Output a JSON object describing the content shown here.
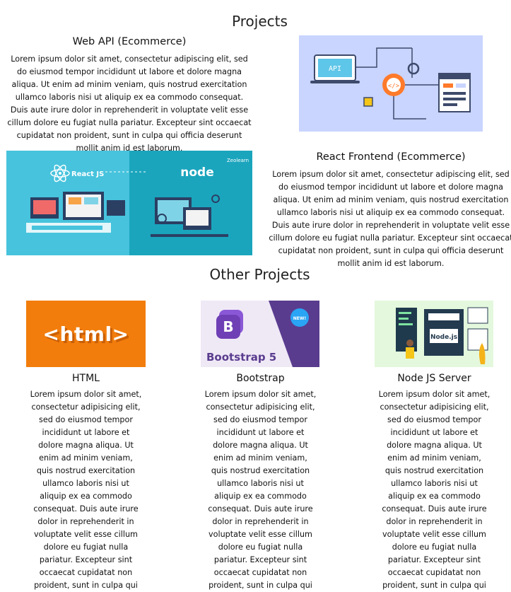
{
  "projects": {
    "heading": "Projects",
    "items": [
      {
        "title": "Web API (Ecommerce)",
        "description": "Lorem ipsum dolor sit amet, consectetur adipiscing elit, sed do eiusmod tempor incididunt ut labore et dolore magna aliqua. Ut enim ad minim veniam, quis nostrud exercitation ullamco laboris nisi ut aliquip ex ea commodo consequat. Duis aute irure dolor in reprehenderit in voluptate velit esse cillum dolore eu fugiat nulla pariatur. Excepteur sint occaecat cupidatat non proident, sunt in culpa qui officia deserunt mollit anim id est laborum.",
        "image_label": "API"
      },
      {
        "title": "React Frontend (Ecommerce)",
        "description": "Lorem ipsum dolor sit amet, consectetur adipiscing elit, sed do eiusmod tempor incididunt ut labore et dolore magna aliqua. Ut enim ad minim veniam, quis nostrud exercitation ullamco laboris nisi ut aliquip ex ea commodo consequat. Duis aute irure dolor in reprehenderit in voluptate velit esse cillum dolore eu fugiat nulla pariatur. Excepteur sint occaecat cupidatat non proident, sunt in culpa qui officia deserunt mollit anim id est laborum.",
        "image_label_left": "React JS",
        "image_label_right": "node",
        "image_brand": "Zeolearn"
      }
    ]
  },
  "other_projects": {
    "heading": "Other Projects",
    "items": [
      {
        "title": "HTML",
        "image_label": "<html>",
        "description": "Lorem ipsum dolor sit amet, consectetur adipisicing elit, sed do eiusmod tempor incididunt ut labore et dolore magna aliqua. Ut enim ad minim veniam, quis nostrud exercitation ullamco laboris nisi ut aliquip ex ea commodo consequat. Duis aute irure dolor in reprehenderit in voluptate velit esse cillum dolore eu fugiat nulla pariatur. Excepteur sint occaecat cupidatat non proident, sunt in culpa qui"
      },
      {
        "title": "Bootstrap",
        "image_label": "Bootstrap 5",
        "image_badge": "NEW!",
        "description": "Lorem ipsum dolor sit amet, consectetur adipisicing elit, sed do eiusmod tempor incididunt ut labore et dolore magna aliqua. Ut enim ad minim veniam, quis nostrud exercitation ullamco laboris nisi ut aliquip ex ea commodo consequat. Duis aute irure dolor in reprehenderit in voluptate velit esse cillum dolore eu fugiat nulla pariatur. Excepteur sint occaecat cupidatat non proident, sunt in culpa qui"
      },
      {
        "title": "Node JS Server",
        "image_label": "Node.js",
        "description": "Lorem ipsum dolor sit amet, consectetur adipisicing elit, sed do eiusmod tempor incididunt ut labore et dolore magna aliqua. Ut enim ad minim veniam, quis nostrud exercitation ullamco laboris nisi ut aliquip ex ea commodo consequat. Duis aute irure dolor in reprehenderit in voluptate velit esse cillum dolore eu fugiat nulla pariatur. Excepteur sint occaecat cupidatat non proident, sunt in culpa qui"
      }
    ]
  },
  "colors": {
    "html_orange": "#f27d0c",
    "bootstrap_purple": "#6f3fb5",
    "api_bg": "#c9d4ff",
    "react_node_bg": "#34b6d0"
  }
}
